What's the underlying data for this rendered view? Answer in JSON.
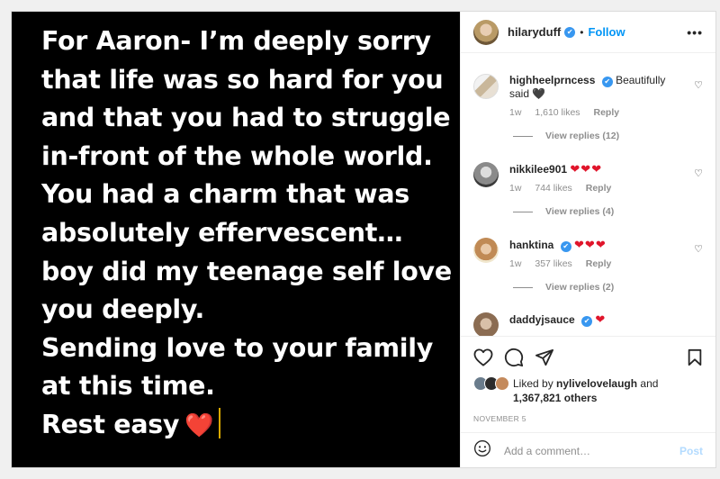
{
  "post": {
    "note_lines": [
      "For Aaron- I’m deeply sorry",
      "that life was so hard for you",
      "and that you had to struggle",
      "in-front of the whole world.",
      "You had a charm that was",
      "absolutely effervescent…",
      "boy did my teenage self love",
      "you deeply.",
      "Sending love to your family",
      "at this time.",
      "Rest easy"
    ],
    "last_line_emoji": "❤️"
  },
  "header": {
    "username": "hilaryduff",
    "verified_mark": "✔",
    "separator": "•",
    "follow_label": "Follow",
    "more_label": "•••"
  },
  "comments": [
    {
      "username": "highheelprncess",
      "verified": true,
      "text": "Beautifully said",
      "text_emoji": "🖤",
      "time": "1w",
      "likes": "1,610 likes",
      "reply": "Reply",
      "replies": "View replies (12)"
    },
    {
      "username": "nikkilee901",
      "verified": false,
      "text": "",
      "text_emoji": "❤❤❤",
      "time": "1w",
      "likes": "744 likes",
      "reply": "Reply",
      "replies": "View replies (4)"
    },
    {
      "username": "hanktina",
      "verified": true,
      "text": "",
      "text_emoji": "❤❤❤",
      "time": "1w",
      "likes": "357 likes",
      "reply": "Reply",
      "replies": "View replies (2)"
    },
    {
      "username": "daddyjsauce",
      "verified": true,
      "text": "",
      "text_emoji": "❤"
    }
  ],
  "actions": {
    "liked_by_prefix": "Liked by",
    "liked_by_user": "nylivelovelaugh",
    "and_label": "and",
    "others_count": "1,367,821 others",
    "date": "NOVEMBER 5"
  },
  "add_comment": {
    "placeholder": "Add a comment…",
    "post_label": "Post"
  },
  "colors": {
    "accent": "#0095f6",
    "verified": "#3897f0",
    "heart": "#e0152b",
    "media_bg": "#000000"
  }
}
